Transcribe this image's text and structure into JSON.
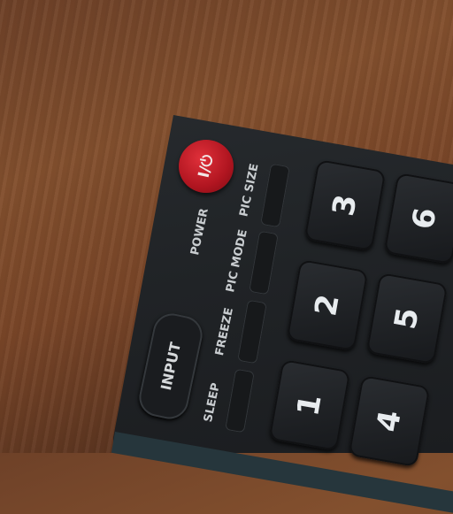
{
  "scene": {
    "description_colors": {
      "wood": "#7a4628",
      "remote_body": "#222528",
      "power_button": "#c41c26"
    }
  },
  "remote": {
    "power_button_label": "I/⏻",
    "labels": {
      "power": "POWER",
      "pic_size": "PIC SIZE",
      "pic_mode": "PIC MODE",
      "freeze": "FREEZE",
      "sleep": "SLEEP"
    },
    "input_button_label": "INPUT",
    "number_keys": [
      "1",
      "2",
      "3",
      "4",
      "5",
      "6"
    ]
  }
}
